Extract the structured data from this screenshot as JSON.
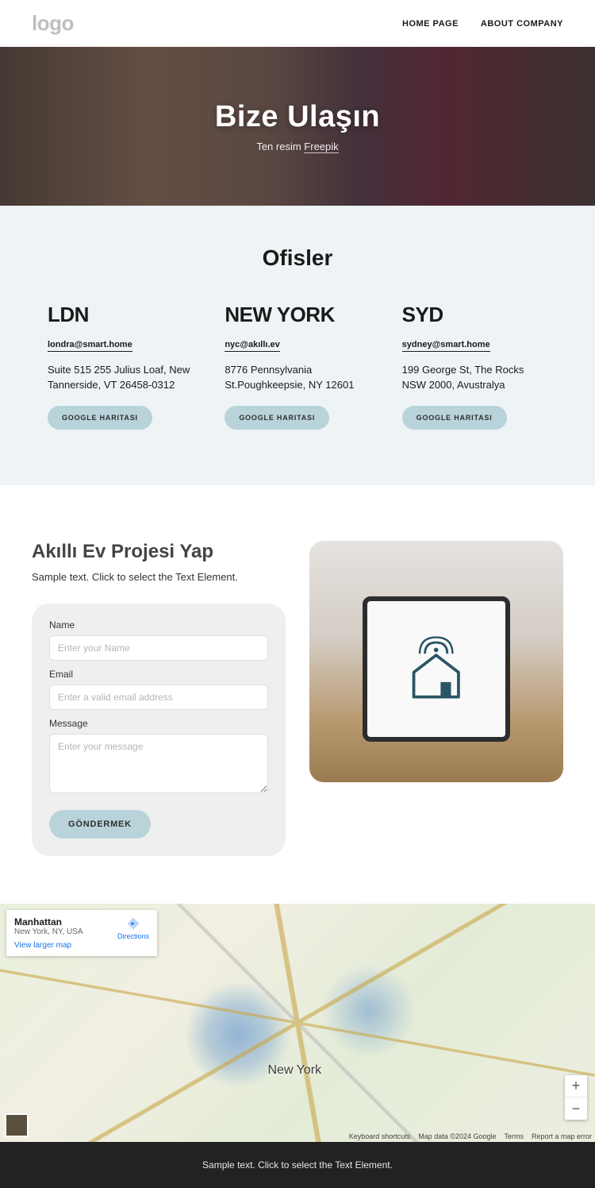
{
  "header": {
    "logo": "logo",
    "nav": [
      "HOME PAGE",
      "ABOUT COMPANY"
    ]
  },
  "hero": {
    "title": "Bize Ulaşın",
    "caption_prefix": "Ten resim ",
    "caption_link": "Freepik"
  },
  "offices": {
    "heading": "Ofisler",
    "button_label": "GOOGLE HARITASI",
    "items": [
      {
        "city": "LDN",
        "email": "londra@smart.home",
        "address": "Suite 515 255 Julius Loaf, New Tannerside, VT 26458-0312"
      },
      {
        "city": "NEW YORK",
        "email": "nyc@akıllı.ev",
        "address": "8776 Pennsylvania St.Poughkeepsie, NY 12601"
      },
      {
        "city": "SYD",
        "email": "sydney@smart.home",
        "address": "199 George St, The Rocks NSW 2000, Avustralya"
      }
    ]
  },
  "form": {
    "heading": "Akıllı Ev Projesi Yap",
    "subtext": "Sample text. Click to select the Text Element.",
    "labels": {
      "name": "Name",
      "email": "Email",
      "message": "Message"
    },
    "placeholders": {
      "name": "Enter your Name",
      "email": "Enter a valid email address",
      "message": "Enter your message"
    },
    "submit": "GÖNDERMEK"
  },
  "map": {
    "card_title": "Manhattan",
    "card_sub": "New York, NY, USA",
    "directions": "Directions",
    "larger": "View larger map",
    "city_label": "New York",
    "zoom_in": "+",
    "zoom_out": "−",
    "attrib": [
      "Keyboard shortcuts",
      "Map data ©2024 Google",
      "Terms",
      "Report a map error"
    ]
  },
  "footer": {
    "text": "Sample text. Click to select the Text Element."
  }
}
